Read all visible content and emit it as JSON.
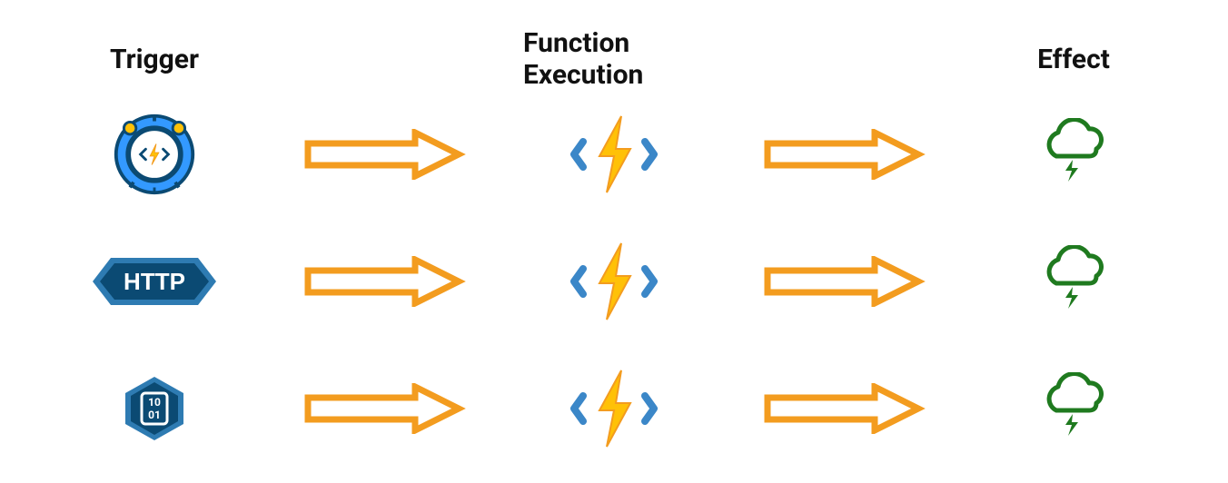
{
  "headers": {
    "trigger": "Trigger",
    "func": "Function Execution",
    "effect": "Effect"
  },
  "rows": [
    {
      "trigger_name": "timer-trigger-icon"
    },
    {
      "trigger_name": "http-trigger-icon",
      "http_label": "HTTP"
    },
    {
      "trigger_name": "event-hub-trigger-icon"
    }
  ],
  "colors": {
    "arrow": "#F39C1F",
    "bolt_bg": "#3B87C8",
    "bolt_fill": "#FFC107",
    "bolt_shade": "#F39C1F",
    "cloud": "#1F7A1F",
    "http_dark": "#0B4A73",
    "http_light": "#2E7BB2"
  }
}
